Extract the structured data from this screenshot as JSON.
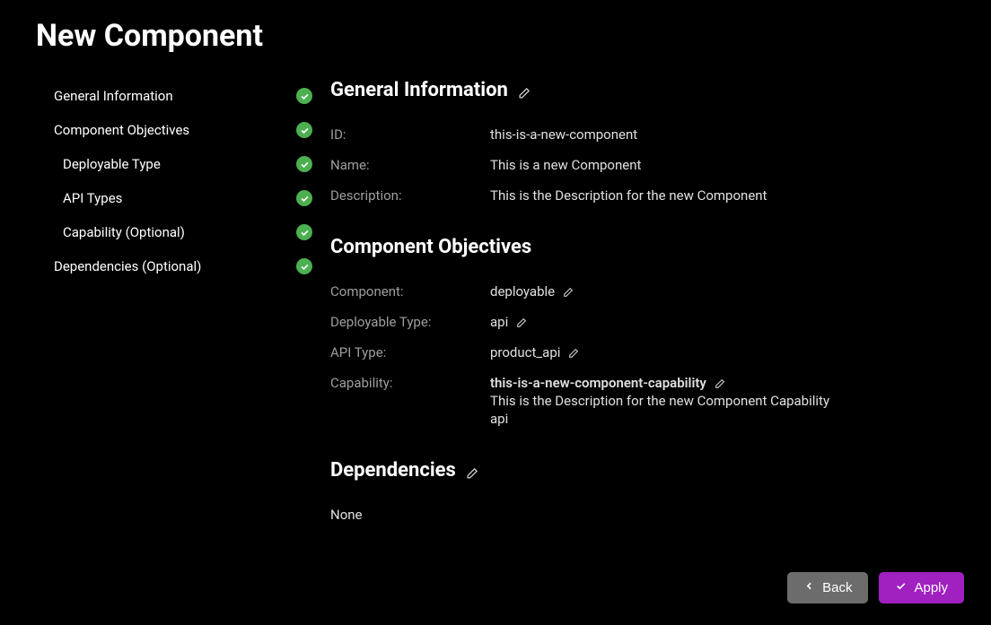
{
  "page_title": "New Component",
  "sidebar": {
    "steps": [
      {
        "label": "General Information",
        "indent": 0
      },
      {
        "label": "Component Objectives",
        "indent": 0
      },
      {
        "label": "Deployable Type",
        "indent": 1
      },
      {
        "label": "API Types",
        "indent": 1
      },
      {
        "label": "Capability (Optional)",
        "indent": 1
      },
      {
        "label": "Dependencies (Optional)",
        "indent": 0
      }
    ]
  },
  "sections": {
    "general": {
      "title": "General Information",
      "id_label": "ID:",
      "id_value": "this-is-a-new-component",
      "name_label": "Name:",
      "name_value": "This is a new Component",
      "desc_label": "Description:",
      "desc_value": "This is the Description for the new Component"
    },
    "objectives": {
      "title": "Component Objectives",
      "component_label": "Component:",
      "component_value": "deployable",
      "deploy_label": "Deployable Type:",
      "deploy_value": "api",
      "api_label": "API Type:",
      "api_value": "product_api",
      "cap_label": "Capability:",
      "cap_name": "this-is-a-new-component-capability",
      "cap_desc": "This is the Description for the new Component Capability",
      "cap_extra": "api"
    },
    "dependencies": {
      "title": "Dependencies",
      "value": "None"
    }
  },
  "footer": {
    "back": "Back",
    "apply": "Apply"
  }
}
